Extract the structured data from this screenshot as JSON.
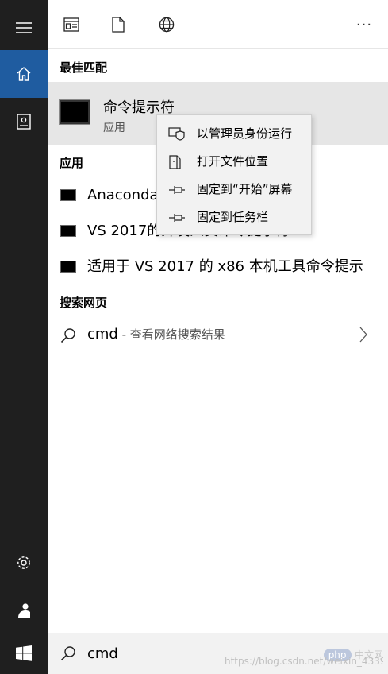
{
  "toolbar": {
    "icons": [
      "document-list-icon",
      "page-icon",
      "globe-icon"
    ],
    "more": "···"
  },
  "sections": {
    "best_match": "最佳匹配",
    "apps": "应用",
    "web": "搜索网页"
  },
  "best_match": {
    "title": "命令提示符",
    "subtitle": "应用"
  },
  "apps": [
    {
      "label": "Anaconda Prompt"
    },
    {
      "label": "VS 2017的开发人员命令提示符"
    },
    {
      "label": "适用于 VS 2017 的 x86 本机工具命令提示"
    }
  ],
  "web_result": {
    "query": "cmd",
    "suffix": " - 查看网络搜索结果"
  },
  "context_menu": {
    "items": [
      {
        "label": "以管理员身份运行",
        "icon": "shield-icon"
      },
      {
        "label": "打开文件位置",
        "icon": "folder-icon"
      },
      {
        "label": "固定到“开始”屏幕",
        "icon": "pin-icon"
      },
      {
        "label": "固定到任务栏",
        "icon": "pin-icon"
      }
    ]
  },
  "search": {
    "value": "cmd"
  },
  "watermark": {
    "php": "php",
    "cn": "中文网",
    "url": "https://blog.csdn.net/weixin_43395911"
  },
  "colors": {
    "rail": "#1f1f1f",
    "accent": "#1f5ca0",
    "highlight": "#e6e6e6"
  }
}
